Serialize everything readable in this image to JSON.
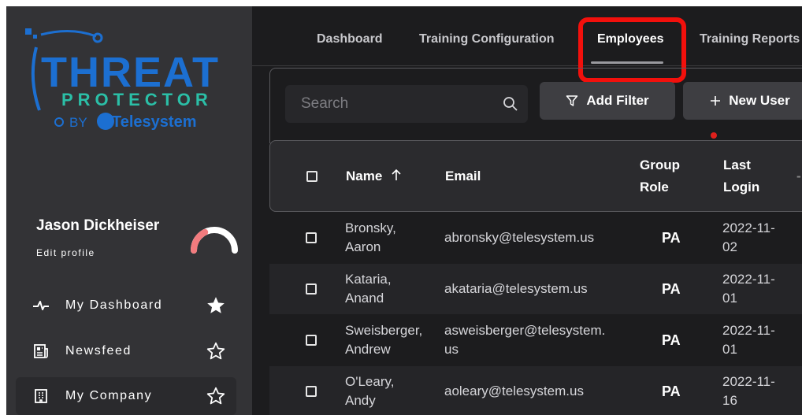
{
  "brand": {
    "logo_line1": "THREAT",
    "logo_line2": "PROTECTOR",
    "logo_by": "BY",
    "logo_company": "Telesystem",
    "colors": {
      "blue": "#1c6fd1",
      "teal": "#2bbfa7",
      "red": "#f2100c"
    }
  },
  "profile": {
    "name": "Jason Dickheiser",
    "edit_label": "Edit profile",
    "gauge_value": 0.35
  },
  "nav": [
    {
      "label": "My Dashboard",
      "icon": "pulse-icon",
      "starred": true,
      "active": false
    },
    {
      "label": "Newsfeed",
      "icon": "newspaper-icon",
      "starred": false,
      "active": false
    },
    {
      "label": "My Company",
      "icon": "building-icon",
      "starred": false,
      "active": true
    }
  ],
  "tabs": [
    {
      "label": "Dashboard",
      "active": false
    },
    {
      "label": "Training Configuration",
      "active": false
    },
    {
      "label": "Employees",
      "active": true
    },
    {
      "label": "Training Reports",
      "active": false
    }
  ],
  "toolbar": {
    "search_placeholder": "Search",
    "add_filter_label": "Add Filter",
    "new_user_label": "New User"
  },
  "table": {
    "headers": {
      "name": "Name",
      "email": "Email",
      "role_line1": "Group",
      "role_line2": "Role",
      "login_line1": "Last",
      "login_line2": "Login"
    },
    "rows": [
      {
        "name_line1": "Bronsky,",
        "name_line2": "Aaron",
        "email_line1": "abronsky@telesystem.us",
        "email_line2": "",
        "role": "PA",
        "date_line1": "2022-11-",
        "date_line2": "02"
      },
      {
        "name_line1": "Kataria,",
        "name_line2": "Anand",
        "email_line1": "akataria@telesystem.us",
        "email_line2": "",
        "role": "PA",
        "date_line1": "2022-11-",
        "date_line2": "01"
      },
      {
        "name_line1": "Sweisberger,",
        "name_line2": "Andrew",
        "email_line1": "asweisberger@telesystem.",
        "email_line2": "us",
        "role": "PA",
        "date_line1": "2022-11-",
        "date_line2": "01"
      },
      {
        "name_line1": "O'Leary,",
        "name_line2": "Andy",
        "email_line1": "aoleary@telesystem.us",
        "email_line2": "",
        "role": "PA",
        "date_line1": "2022-11-",
        "date_line2": "16"
      }
    ]
  }
}
